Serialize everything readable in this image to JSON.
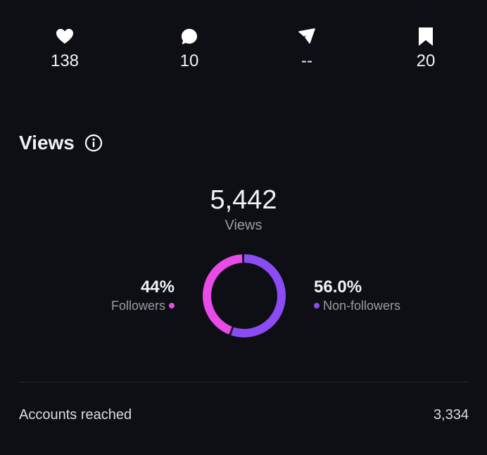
{
  "stats": [
    {
      "icon": "heart-icon",
      "value": "138"
    },
    {
      "icon": "comment-icon",
      "value": "10"
    },
    {
      "icon": "share-icon",
      "value": "--"
    },
    {
      "icon": "bookmark-icon",
      "value": "20"
    }
  ],
  "views": {
    "title": "Views",
    "info_icon": "info-icon",
    "total": "5,442",
    "total_label": "Views",
    "followers": {
      "percent": "44%",
      "label": "Followers",
      "share": 0.44,
      "color": "#e84be8"
    },
    "non_followers": {
      "percent": "56.0%",
      "label": "Non-followers",
      "share": 0.56,
      "color": "#8b4cf5"
    }
  },
  "accounts_reached": {
    "label": "Accounts reached",
    "value": "3,334"
  },
  "colors": {
    "background": "#0e0f14",
    "text": "#f2f2f4",
    "muted": "#9a9ba3",
    "divider": "#262830"
  }
}
